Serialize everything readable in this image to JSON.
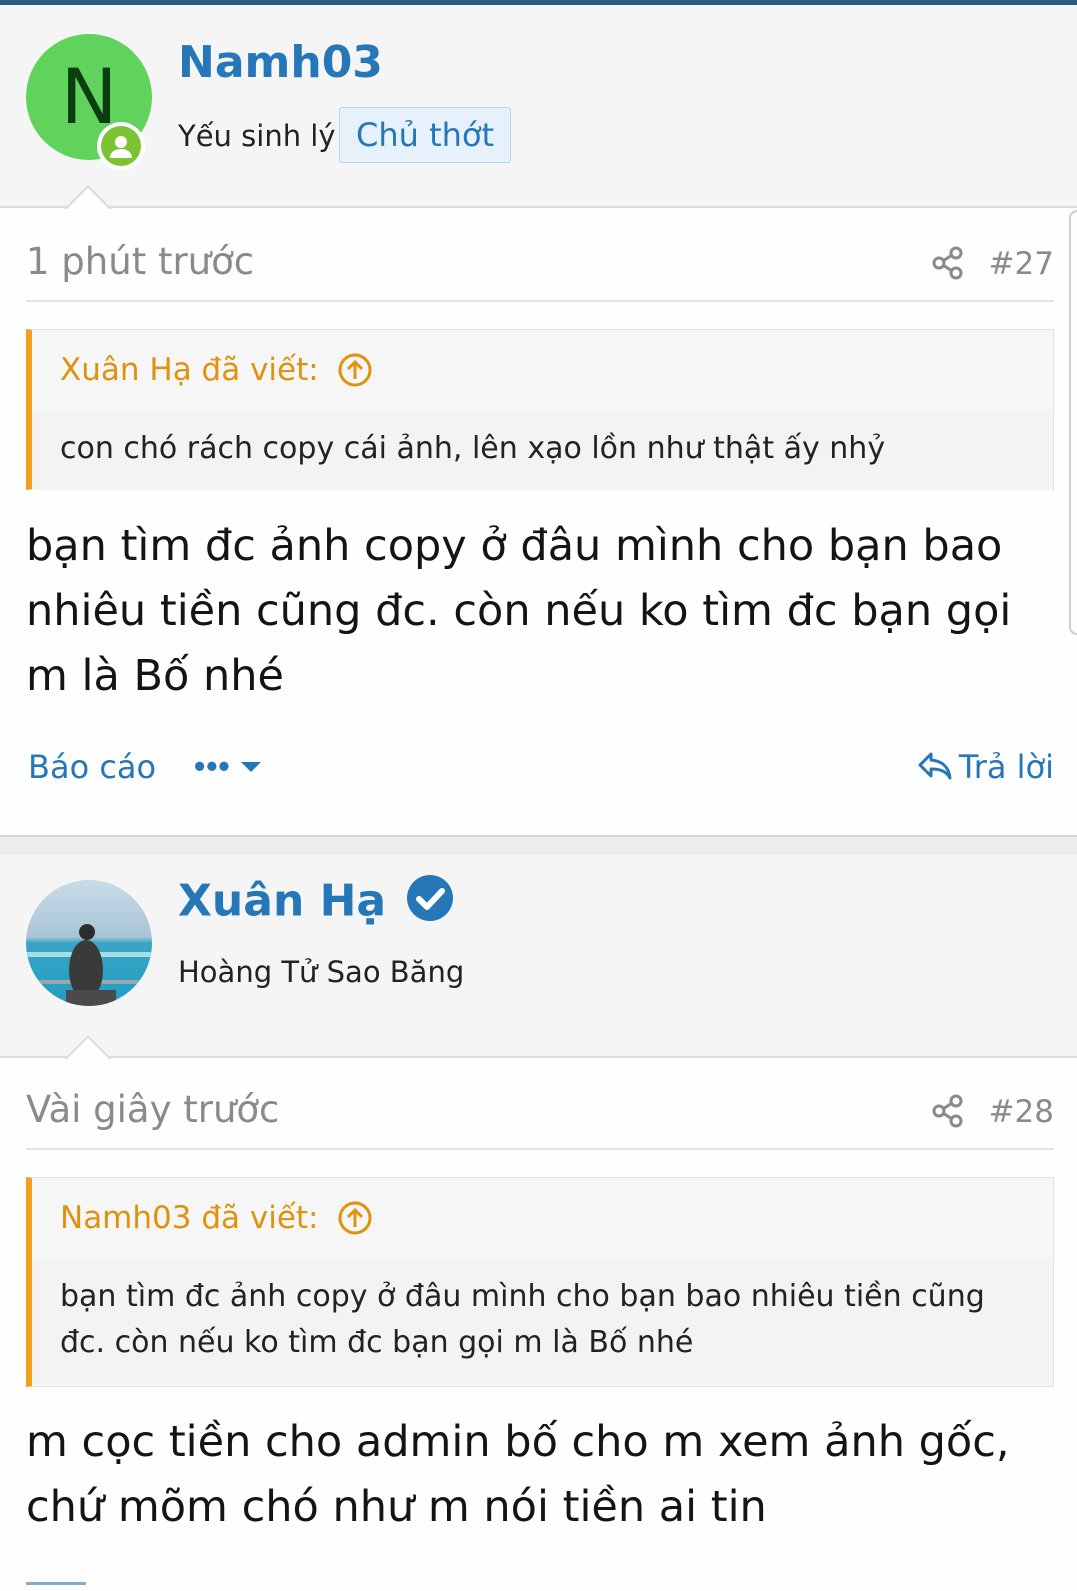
{
  "posts": [
    {
      "username": "Namh03",
      "avatar_letter": "N",
      "user_title": "Yếu sinh lý",
      "badge": "Chủ thớt",
      "online_icon": "user-online-icon",
      "time": "1 phút trước",
      "post_number": "#27",
      "quote": {
        "author": "Xuân Hạ đã viết:",
        "text": "con chó rách copy cái ảnh, lên xạo lồn như thật ấy nhỷ"
      },
      "message": "bạn tìm đc ảnh copy ở đâu mình cho bạn bao nhiêu tiền cũng đc. còn nếu ko tìm đc bạn gọi m là Bố nhé",
      "actions": {
        "report": "Báo cáo",
        "more": "•••",
        "reply": "Trả lời"
      }
    },
    {
      "username": "Xuân Hạ",
      "verified": true,
      "user_title": "Hoàng Tử Sao Băng",
      "time": "Vài giây trước",
      "post_number": "#28",
      "quote": {
        "author": "Namh03 đã viết:",
        "text": "bạn tìm đc ảnh copy ở đâu mình cho bạn bao nhiêu tiền cũng đc. còn nếu ko tìm đc bạn gọi m là Bố nhé"
      },
      "message": "m cọc tiền cho admin bố cho m xem ảnh gốc, chứ mõm chó như m nói tiền ai tin"
    }
  ],
  "colors": {
    "link": "#2577b8",
    "quote_accent": "#f0a11d",
    "online": "#7cc332",
    "avatar_bg": "#5fd35b"
  }
}
